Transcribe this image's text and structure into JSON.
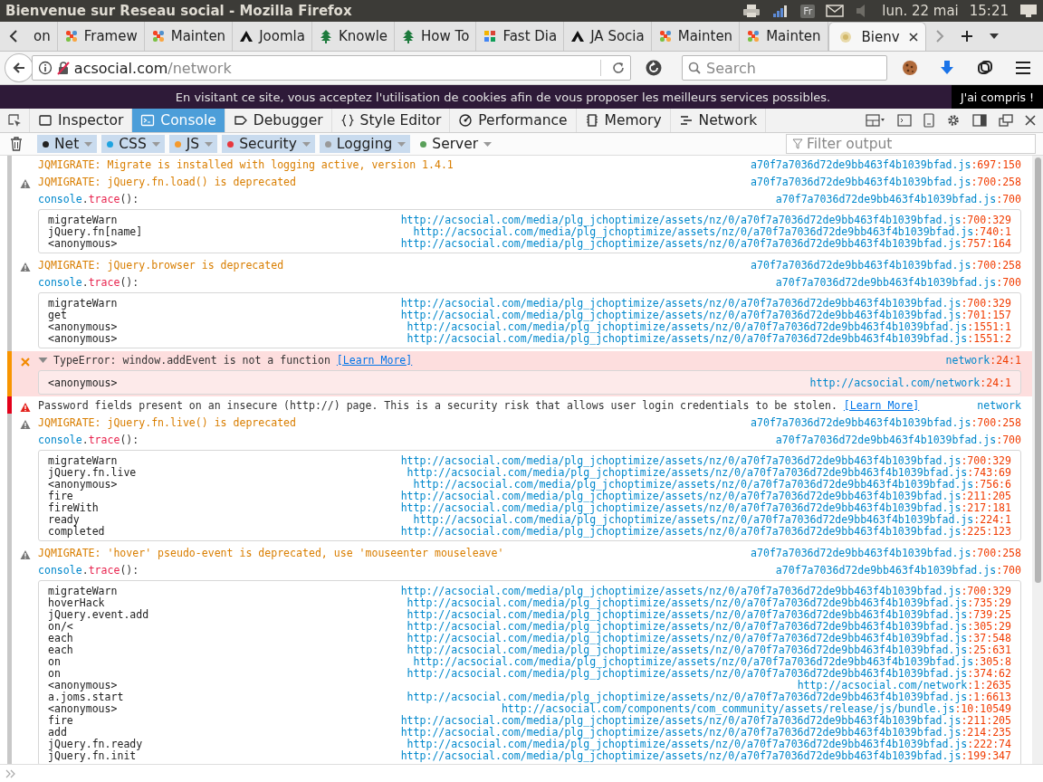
{
  "window": {
    "title": "Bienvenue sur Reseau social - Mozilla Firefox"
  },
  "system_tray": {
    "keyboard_layout": "Fr",
    "date": "lun. 22 mai",
    "time": "15:21"
  },
  "tabs": [
    {
      "title": "on",
      "kind": "cut",
      "selected": false
    },
    {
      "title": "Framew",
      "kind": "cross",
      "selected": false
    },
    {
      "title": "Mainten",
      "kind": "cross",
      "selected": false
    },
    {
      "title": "Joomla",
      "kind": "triangle",
      "selected": false
    },
    {
      "title": "Knowle",
      "kind": "tree",
      "selected": false
    },
    {
      "title": "How To",
      "kind": "tree",
      "selected": false
    },
    {
      "title": "Fast Dia",
      "kind": "squares",
      "selected": false
    },
    {
      "title": "JA Socia",
      "kind": "triangle",
      "selected": false
    },
    {
      "title": "Mainten",
      "kind": "cross",
      "selected": false
    },
    {
      "title": "Mainten",
      "kind": "cross",
      "selected": false
    },
    {
      "title": "Bienv",
      "kind": "blank",
      "selected": true
    }
  ],
  "address_bar": {
    "host": "acsocial.com",
    "path": "/network"
  },
  "search": {
    "placeholder": "Search"
  },
  "cookie_banner": {
    "text": "En visitant ce site, vous acceptez l'utilisation de cookies afin de vous proposer les meilleurs services possibles.",
    "button": "J'ai compris !"
  },
  "devtools": {
    "tabs": [
      {
        "label": "Inspector",
        "kind": "inspector",
        "selected": false
      },
      {
        "label": "Console",
        "kind": "console",
        "selected": true
      },
      {
        "label": "Debugger",
        "kind": "debugger",
        "selected": false
      },
      {
        "label": "Style Editor",
        "kind": "style",
        "selected": false
      },
      {
        "label": "Performance",
        "kind": "performance",
        "selected": false
      },
      {
        "label": "Memory",
        "kind": "memory",
        "selected": false
      },
      {
        "label": "Network",
        "kind": "network",
        "selected": false
      }
    ],
    "filters": [
      {
        "label": "Net",
        "color": "#222222",
        "selected": true
      },
      {
        "label": "CSS",
        "color": "#1fa3e0",
        "selected": true
      },
      {
        "label": "JS",
        "color": "#f59a2c",
        "selected": true
      },
      {
        "label": "Security",
        "color": "#e8373e",
        "selected": true
      },
      {
        "label": "Logging",
        "color": "#9a9a9a",
        "selected": true
      },
      {
        "label": "Server",
        "color": "#5aa05a",
        "selected": false
      }
    ],
    "filter_field": {
      "placeholder": "Filter output"
    },
    "entries": [
      {
        "kind": "notice",
        "text": "JQMIGRATE: Migrate is installed with logging active, version 1.4.1",
        "file": "a70f7a7036d72de9bb463f4b1039bfad.js",
        "loc": ":697:150"
      },
      {
        "kind": "warning",
        "text": "JQMIGRATE: jQuery.fn.load() is deprecated",
        "file": "a70f7a7036d72de9bb463f4b1039bfad.js",
        "loc": ":700:258"
      },
      {
        "kind": "trace",
        "call_parts": [
          "console",
          ".",
          "trace",
          "():"
        ],
        "file": "a70f7a7036d72de9bb463f4b1039bfad.js",
        "loc": ":700",
        "frames": [
          {
            "fn": "migrateWarn",
            "url": "http://acsocial.com/media/plg_jchoptimize/assets/nz/0/a70f7a7036d72de9bb463f4b1039bfad.js",
            "loc": ":700:329"
          },
          {
            "fn": "jQuery.fn[name]",
            "url": "http://acsocial.com/media/plg_jchoptimize/assets/nz/0/a70f7a7036d72de9bb463f4b1039bfad.js",
            "loc": ":740:1"
          },
          {
            "fn": "<anonymous>",
            "url": "http://acsocial.com/media/plg_jchoptimize/assets/nz/0/a70f7a7036d72de9bb463f4b1039bfad.js",
            "loc": ":757:164"
          }
        ]
      },
      {
        "kind": "warning",
        "text": "JQMIGRATE: jQuery.browser is deprecated",
        "file": "a70f7a7036d72de9bb463f4b1039bfad.js",
        "loc": ":700:258"
      },
      {
        "kind": "trace",
        "call_parts": [
          "console",
          ".",
          "trace",
          "():"
        ],
        "file": "a70f7a7036d72de9bb463f4b1039bfad.js",
        "loc": ":700",
        "frames": [
          {
            "fn": "migrateWarn",
            "url": "http://acsocial.com/media/plg_jchoptimize/assets/nz/0/a70f7a7036d72de9bb463f4b1039bfad.js",
            "loc": ":700:329"
          },
          {
            "fn": "get",
            "url": "http://acsocial.com/media/plg_jchoptimize/assets/nz/0/a70f7a7036d72de9bb463f4b1039bfad.js",
            "loc": ":701:157"
          },
          {
            "fn": "<anonymous>",
            "url": "http://acsocial.com/media/plg_jchoptimize/assets/nz/0/a70f7a7036d72de9bb463f4b1039bfad.js",
            "loc": ":1551:1"
          },
          {
            "fn": "<anonymous>",
            "url": "http://acsocial.com/media/plg_jchoptimize/assets/nz/0/a70f7a7036d72de9bb463f4b1039bfad.js",
            "loc": ":1551:2"
          }
        ]
      },
      {
        "kind": "error",
        "expanded": true,
        "text": "TypeError: window.addEvent is not a function",
        "link": "[Learn More]",
        "file": "network",
        "loc": ":24:1",
        "frames": [
          {
            "fn": "<anonymous>",
            "url": "http://acsocial.com/network",
            "loc": ":24:1"
          }
        ]
      },
      {
        "kind": "security",
        "text": "Password fields present on an insecure (http://) page. This is a security risk that allows user login credentials to be stolen.",
        "link": "[Learn More]",
        "file": "network"
      },
      {
        "kind": "warning",
        "text": "JQMIGRATE: jQuery.fn.live() is deprecated",
        "file": "a70f7a7036d72de9bb463f4b1039bfad.js",
        "loc": ":700:258"
      },
      {
        "kind": "trace",
        "call_parts": [
          "console",
          ".",
          "trace",
          "():"
        ],
        "file": "a70f7a7036d72de9bb463f4b1039bfad.js",
        "loc": ":700",
        "frames": [
          {
            "fn": "migrateWarn",
            "url": "http://acsocial.com/media/plg_jchoptimize/assets/nz/0/a70f7a7036d72de9bb463f4b1039bfad.js",
            "loc": ":700:329"
          },
          {
            "fn": "jQuery.fn.live",
            "url": "http://acsocial.com/media/plg_jchoptimize/assets/nz/0/a70f7a7036d72de9bb463f4b1039bfad.js",
            "loc": ":743:69"
          },
          {
            "fn": "<anonymous>",
            "url": "http://acsocial.com/media/plg_jchoptimize/assets/nz/0/a70f7a7036d72de9bb463f4b1039bfad.js",
            "loc": ":756:6"
          },
          {
            "fn": "fire",
            "url": "http://acsocial.com/media/plg_jchoptimize/assets/nz/0/a70f7a7036d72de9bb463f4b1039bfad.js",
            "loc": ":211:205"
          },
          {
            "fn": "fireWith",
            "url": "http://acsocial.com/media/plg_jchoptimize/assets/nz/0/a70f7a7036d72de9bb463f4b1039bfad.js",
            "loc": ":217:181"
          },
          {
            "fn": "ready",
            "url": "http://acsocial.com/media/plg_jchoptimize/assets/nz/0/a70f7a7036d72de9bb463f4b1039bfad.js",
            "loc": ":224:1"
          },
          {
            "fn": "completed",
            "url": "http://acsocial.com/media/plg_jchoptimize/assets/nz/0/a70f7a7036d72de9bb463f4b1039bfad.js",
            "loc": ":225:123"
          }
        ]
      },
      {
        "kind": "warning",
        "text": "JQMIGRATE: 'hover' pseudo-event is deprecated, use 'mouseenter mouseleave'",
        "file": "a70f7a7036d72de9bb463f4b1039bfad.js",
        "loc": ":700:258"
      },
      {
        "kind": "trace",
        "call_parts": [
          "console",
          ".",
          "trace",
          "():"
        ],
        "file": "a70f7a7036d72de9bb463f4b1039bfad.js",
        "loc": ":700",
        "frames": [
          {
            "fn": "migrateWarn",
            "url": "http://acsocial.com/media/plg_jchoptimize/assets/nz/0/a70f7a7036d72de9bb463f4b1039bfad.js",
            "loc": ":700:329"
          },
          {
            "fn": "hoverHack",
            "url": "http://acsocial.com/media/plg_jchoptimize/assets/nz/0/a70f7a7036d72de9bb463f4b1039bfad.js",
            "loc": ":735:29"
          },
          {
            "fn": "jQuery.event.add",
            "url": "http://acsocial.com/media/plg_jchoptimize/assets/nz/0/a70f7a7036d72de9bb463f4b1039bfad.js",
            "loc": ":739:25"
          },
          {
            "fn": "on/<",
            "url": "http://acsocial.com/media/plg_jchoptimize/assets/nz/0/a70f7a7036d72de9bb463f4b1039bfad.js",
            "loc": ":305:29"
          },
          {
            "fn": "each",
            "url": "http://acsocial.com/media/plg_jchoptimize/assets/nz/0/a70f7a7036d72de9bb463f4b1039bfad.js",
            "loc": ":37:548"
          },
          {
            "fn": "each",
            "url": "http://acsocial.com/media/plg_jchoptimize/assets/nz/0/a70f7a7036d72de9bb463f4b1039bfad.js",
            "loc": ":25:631"
          },
          {
            "fn": "on",
            "url": "http://acsocial.com/media/plg_jchoptimize/assets/nz/0/a70f7a7036d72de9bb463f4b1039bfad.js",
            "loc": ":305:8"
          },
          {
            "fn": "on",
            "url": "http://acsocial.com/media/plg_jchoptimize/assets/nz/0/a70f7a7036d72de9bb463f4b1039bfad.js",
            "loc": ":374:62"
          },
          {
            "fn": "<anonymous>",
            "url": "http://acsocial.com/network",
            "loc": ":1:2635"
          },
          {
            "fn": "a.joms.start",
            "url": "http://acsocial.com/media/plg_jchoptimize/assets/nz/0/a70f7a7036d72de9bb463f4b1039bfad.js",
            "loc": ":1:6613"
          },
          {
            "fn": "<anonymous>",
            "url": "http://acsocial.com/components/com_community/assets/release/js/bundle.js",
            "loc": ":10:10549"
          },
          {
            "fn": "fire",
            "url": "http://acsocial.com/media/plg_jchoptimize/assets/nz/0/a70f7a7036d72de9bb463f4b1039bfad.js",
            "loc": ":211:205"
          },
          {
            "fn": "add",
            "url": "http://acsocial.com/media/plg_jchoptimize/assets/nz/0/a70f7a7036d72de9bb463f4b1039bfad.js",
            "loc": ":214:235"
          },
          {
            "fn": "jQuery.fn.ready",
            "url": "http://acsocial.com/media/plg_jchoptimize/assets/nz/0/a70f7a7036d72de9bb463f4b1039bfad.js",
            "loc": ":222:74"
          },
          {
            "fn": "jQuery.fn.init",
            "url": "http://acsocial.com/media/plg_jchoptimize/assets/nz/0/a70f7a7036d72de9bb463f4b1039bfad.js",
            "loc": ":199:347"
          }
        ]
      }
    ]
  }
}
